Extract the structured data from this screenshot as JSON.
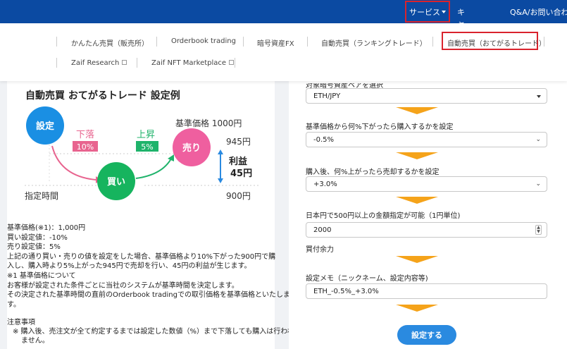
{
  "topnav": {
    "service_label": "サービス",
    "campaign_label": "キャンペーン",
    "qa_label": "Q&A/お問い合わせ"
  },
  "dropdown": {
    "items": [
      "かんたん売買（販売所）",
      "Orderbook trading",
      "暗号資産FX",
      "自動売買（ランキングトレード）",
      "自動売買（おてがるトレード）"
    ],
    "row2": [
      "Zaif Research",
      "Zaif NFT Marketplace"
    ]
  },
  "left": {
    "title": "自動売買 おてがるトレード 設定例",
    "diagram": {
      "setting": "設定",
      "fall": "下落",
      "fall_pct": "10%",
      "rise": "上昇",
      "rise_pct": "5%",
      "sell": "売り",
      "buy": "買い",
      "base_price": "基準価格 1000円",
      "price_945": "945円",
      "price_900": "900円",
      "profit": "利益",
      "profit_amount": "45円",
      "time_label": "指定時間"
    },
    "lines": [
      "基準価格(※1)：1,000円",
      "買い設定値：-10%",
      "売り設定値：5%",
      "上記の通り買い・売りの値を設定をした場合、基準価格より10%下がった900円で購",
      "入し、購入時より5%上がった945円で売却を行い、45円の利益が生じます。",
      "※1 基準価格について",
      "お客様が設定された条件ごとに当社のシステムが基準時間を決定します。",
      "その決定された基準時間の直前のOrderbook tradingでの取引価格を基準価格といたしま",
      "す。"
    ],
    "notes_title": "注意事項",
    "notes_lines": [
      "※ 購入後、売注文が全て約定するまでは設定した数値（%）まで下落しても購入は行われ",
      "ません。"
    ]
  },
  "right": {
    "pair_label_partial": "対象暗号資産ペアを選択",
    "pair_value": "ETH/JPY",
    "buy_label": "基準価格から何%下がったら購入するかを設定",
    "buy_value": "-0.5%",
    "sell_label": "購入後、何%上がったら売却するかを設定",
    "sell_value": "+3.0%",
    "amount_label": "日本円で500円以上の金額指定が可能（1円単位)",
    "amount_value": "2000",
    "balance_label": "買付余力",
    "memo_label": "設定メモ（ニックネーム、設定内容等)",
    "memo_value": "ETH_-0.5%_+3.0%",
    "submit_label": "設定する"
  },
  "colors": {
    "nav_blue": "#0b4aa2",
    "highlight_red": "#d9232d",
    "setting_blue": "#1a8fe3",
    "fall_pink": "#e8648f",
    "rise_green": "#1fb36b",
    "sell_pink": "#ef5f9f",
    "buy_green": "#16b45e",
    "arrow_orange": "#f5a31a",
    "submit_blue": "#2a8ae0"
  }
}
